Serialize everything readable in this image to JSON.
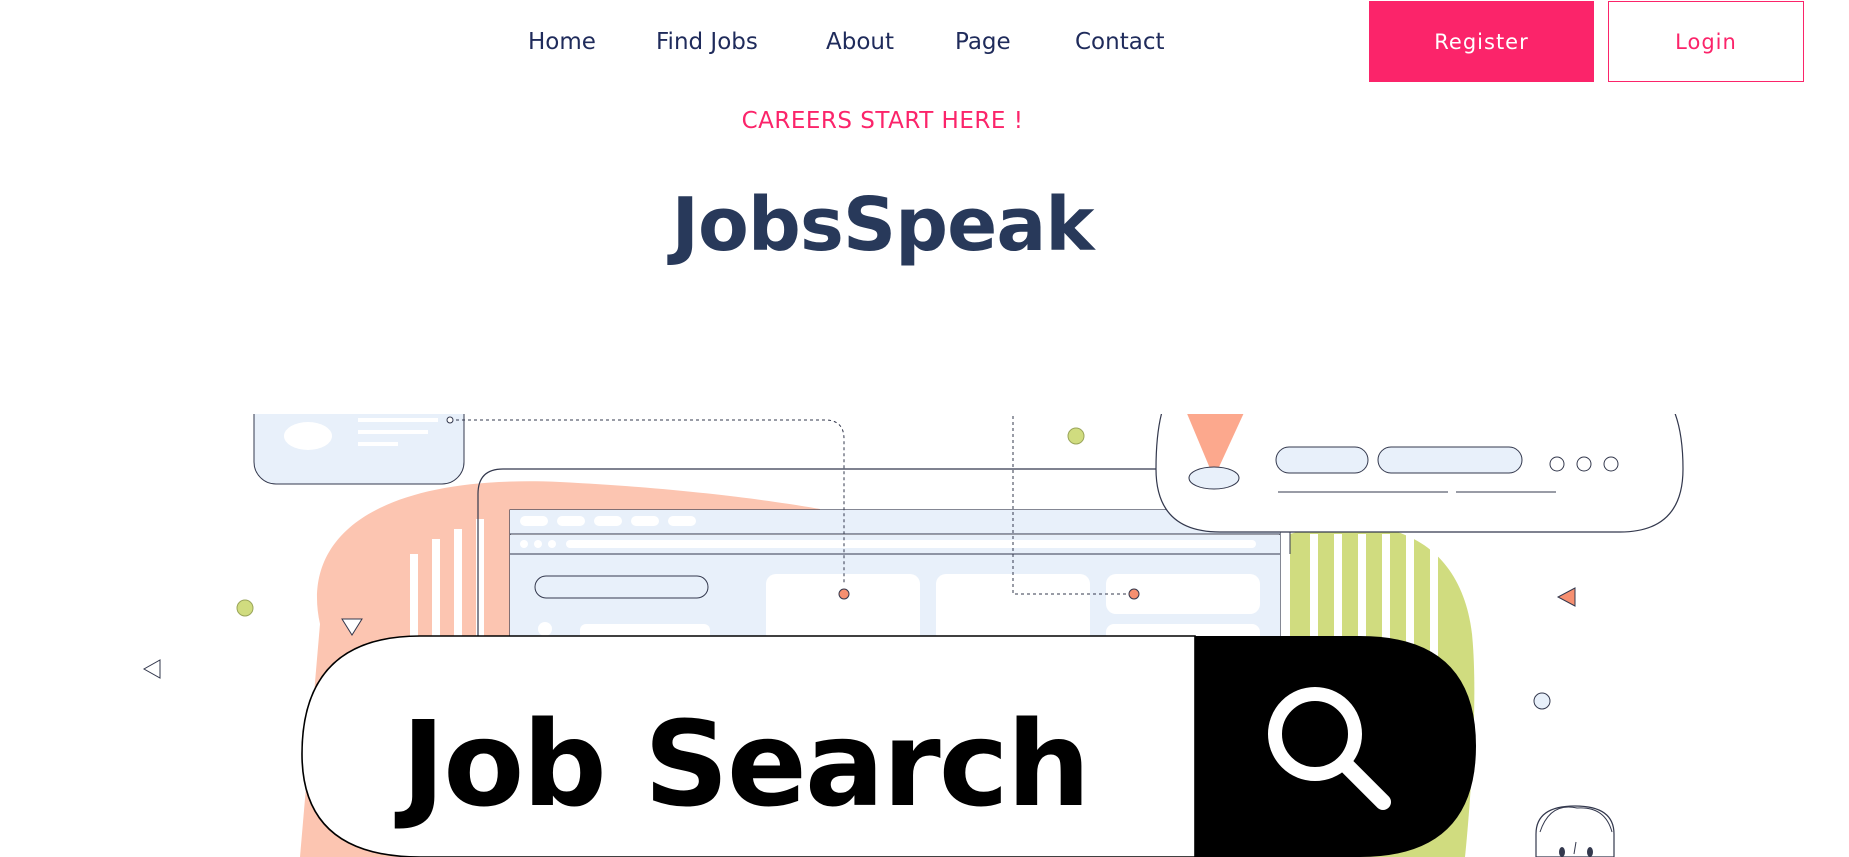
{
  "nav": {
    "links": [
      "Home",
      "Find Jobs",
      "About",
      "Page",
      "Contact"
    ],
    "register_label": "Register",
    "login_label": "Login"
  },
  "hero": {
    "tagline": "CAREERS START HERE !",
    "title": "JobsSpeak",
    "illustration": {
      "search_text": "Job Search",
      "search_icon": "search-icon"
    }
  },
  "colors": {
    "accent": "#fb246a",
    "nav_text": "#1f2b5b",
    "heading": "#28395a",
    "peach": "#fcc5b1",
    "lime": "#d0dc7f",
    "panel": "#e8f0fa"
  }
}
